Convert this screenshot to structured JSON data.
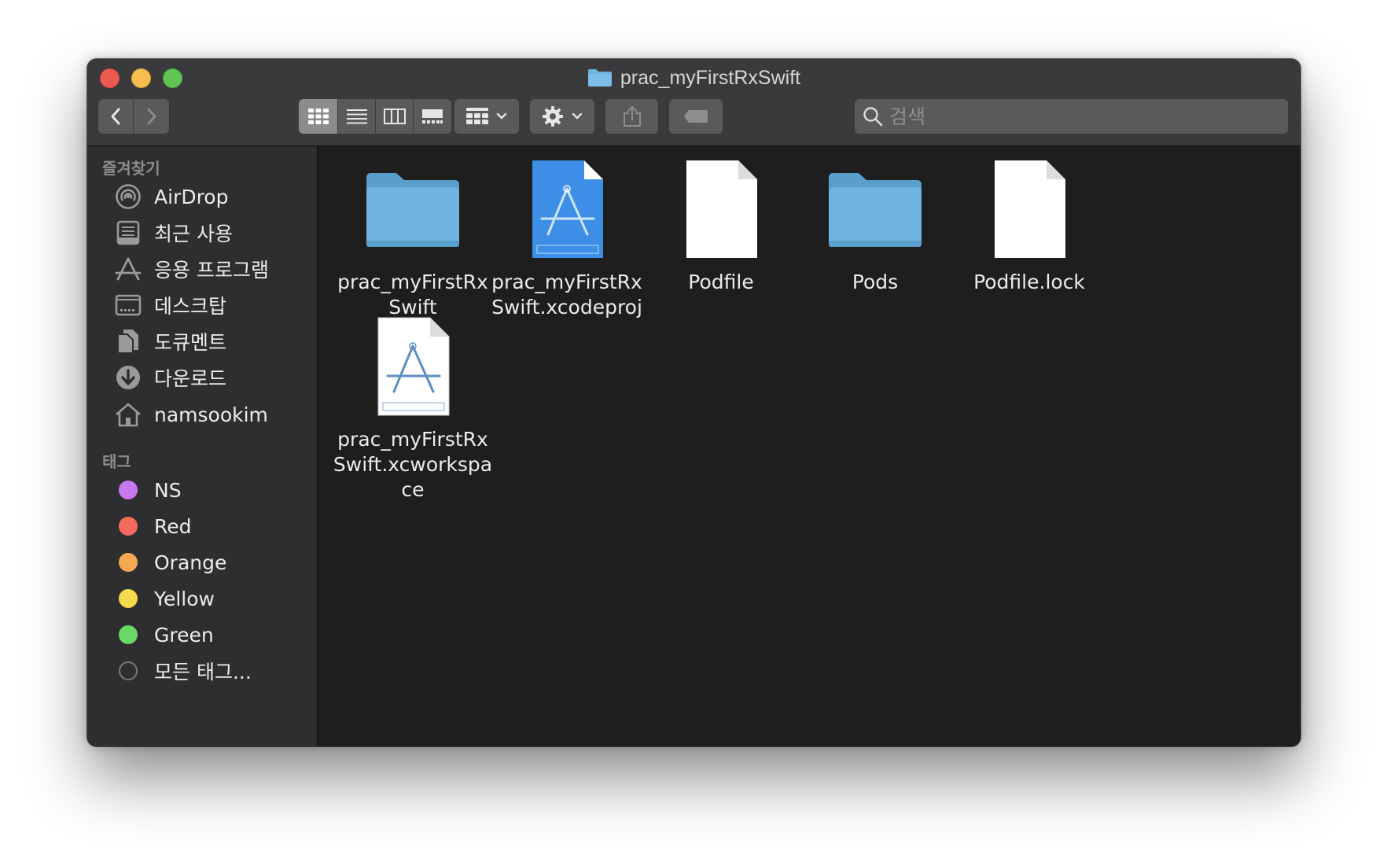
{
  "window": {
    "title": "prac_myFirstRxSwift"
  },
  "toolbar": {
    "back_icon": "chevron-left-icon",
    "forward_icon": "chevron-right-icon",
    "view_modes": [
      "icon-view",
      "list-view",
      "column-view",
      "gallery-view"
    ],
    "active_view": "icon-view",
    "group_icon": "group-by-icon",
    "action_icon": "gear-icon",
    "share_icon": "share-icon",
    "tag_icon": "tag-icon"
  },
  "search": {
    "placeholder": "검색",
    "value": ""
  },
  "sidebar": {
    "favorites_heading": "즐겨찾기",
    "favorites": [
      {
        "label": "AirDrop",
        "icon": "airdrop-icon"
      },
      {
        "label": "최근 사용",
        "icon": "recents-icon"
      },
      {
        "label": "응용 프로그램",
        "icon": "applications-icon"
      },
      {
        "label": "데스크탑",
        "icon": "desktop-icon"
      },
      {
        "label": "도큐멘트",
        "icon": "documents-icon"
      },
      {
        "label": "다운로드",
        "icon": "downloads-icon"
      },
      {
        "label": "namsookim",
        "icon": "home-icon"
      }
    ],
    "tags_heading": "태그",
    "tags": [
      {
        "label": "NS",
        "color": "#c678f0"
      },
      {
        "label": "Red",
        "color": "#f26b5e"
      },
      {
        "label": "Orange",
        "color": "#f5a953"
      },
      {
        "label": "Yellow",
        "color": "#f7d94c"
      },
      {
        "label": "Green",
        "color": "#6ad864"
      },
      {
        "label": "모든 태그...",
        "color": "#2e2e30"
      }
    ]
  },
  "files": [
    {
      "name": "prac_myFirstRxSwift",
      "icon": "folder-icon"
    },
    {
      "name": "prac_myFirstRxSwift.xcodeproj",
      "icon": "xcodeproj-icon"
    },
    {
      "name": "Podfile",
      "icon": "document-icon"
    },
    {
      "name": "Pods",
      "icon": "folder-icon"
    },
    {
      "name": "Podfile.lock",
      "icon": "document-icon"
    },
    {
      "name": "prac_myFirstRxSwift.xcworkspace",
      "icon": "xcworkspace-icon"
    }
  ],
  "colors": {
    "folder_blue": "#6fb3e0",
    "sidebar_bg": "#2e2e30",
    "content_bg": "#1e1e1e",
    "toolbar_bg": "#3a3a3c"
  }
}
